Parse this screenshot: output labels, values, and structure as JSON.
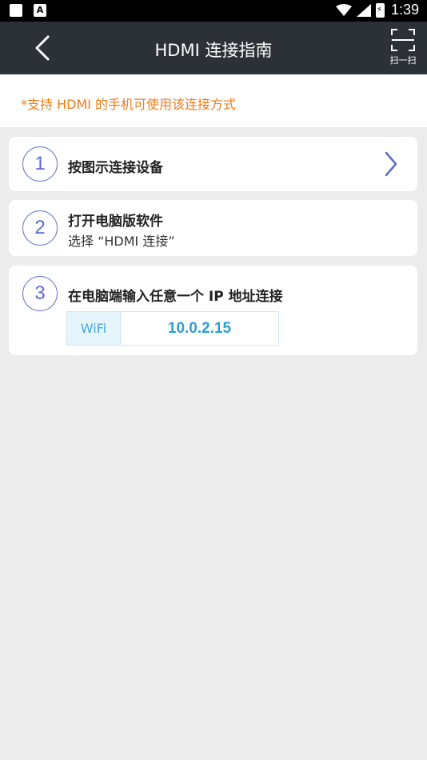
{
  "status_bar": {
    "time": "1:39",
    "battery_glyph": "⚡"
  },
  "app_bar": {
    "title": "HDMI 连接指南",
    "scan_label": "扫一扫"
  },
  "notice": {
    "text": "*支持 HDMI 的手机可使用该连接方式"
  },
  "steps": [
    {
      "number": "1",
      "title": "按图示连接设备"
    },
    {
      "number": "2",
      "title": "打开电脑版软件",
      "subtitle": "选择 “HDMI 连接”"
    },
    {
      "number": "3",
      "title": "在电脑端输入任意一个 IP 地址连接"
    }
  ],
  "ip": {
    "label": "WiFi",
    "value": "10.0.2.15"
  },
  "colors": {
    "accent": "#5b6ccf",
    "notice": "#f07c1a",
    "appbar": "#2c3037",
    "ip": "#2aa0d6"
  }
}
